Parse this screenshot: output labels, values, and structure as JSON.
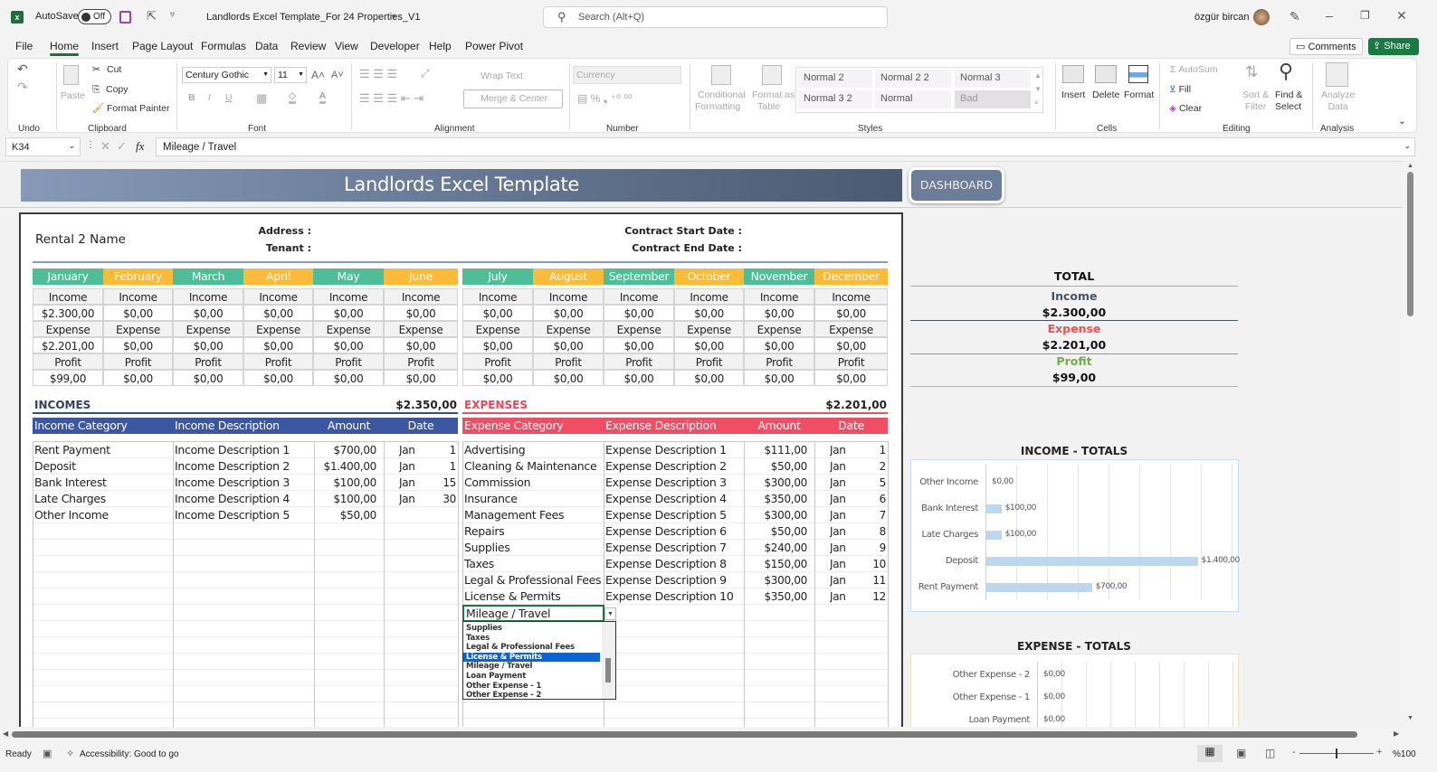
{
  "titlebar": {
    "autosave_label": "AutoSave",
    "autosave_state": "Off",
    "filename": "Landlords Excel Template_For 24 Properties_V1",
    "search_placeholder": "Search (Alt+Q)",
    "user_name": "özgür bircan"
  },
  "menu": {
    "tabs": [
      "File",
      "Home",
      "Insert",
      "Page Layout",
      "Formulas",
      "Data",
      "Review",
      "View",
      "Developer",
      "Help",
      "Power Pivot"
    ],
    "active_tab": "Home",
    "comments_label": "Comments",
    "share_label": "Share"
  },
  "ribbon": {
    "groups": {
      "undo": "Undo",
      "clipboard": "Clipboard",
      "font": "Font",
      "alignment": "Alignment",
      "number": "Number",
      "styles": "Styles",
      "cells": "Cells",
      "editing": "Editing",
      "analysis": "Analysis"
    },
    "paste": "Paste",
    "cut": "Cut",
    "copy": "Copy",
    "format_painter": "Format Painter",
    "font_name": "Century Gothic",
    "font_size": "11",
    "wrap_text": "Wrap Text",
    "merge_center": "Merge & Center",
    "number_format": "Currency",
    "conditional_formatting": [
      "Conditional",
      "Formatting"
    ],
    "format_as_table": [
      "Format as",
      "Table"
    ],
    "styles": [
      "Normal 2",
      "Normal 2 2",
      "Normal 3",
      "Normal 3 2",
      "Normal",
      "Bad"
    ],
    "insert": "Insert",
    "delete": "Delete",
    "format": "Format",
    "autosum": "AutoSum",
    "fill": "Fill",
    "clear": "Clear",
    "sort_filter": [
      "Sort &",
      "Filter"
    ],
    "find_select": [
      "Find &",
      "Select"
    ],
    "analyze_data": [
      "Analyze",
      "Data"
    ]
  },
  "formula_bar": {
    "name_box": "K34",
    "fx": "fx",
    "value": "Mileage / Travel"
  },
  "sheet": {
    "banner_title": "Landlords Excel Template",
    "dashboard_button": "DASHBOARD",
    "rental_name": "Rental 2 Name",
    "address_label": "Address :",
    "tenant_label": "Tenant :",
    "contract_start_label": "Contract Start Date :",
    "contract_end_label": "Contract End Date :",
    "colors": {
      "green": "#4fbd98",
      "orange": "#fbbb3a",
      "income_blue": "#3b57a1",
      "expense_red": "#f14e66"
    },
    "row_labels": [
      "Income",
      "Expense",
      "Profit"
    ],
    "months": [
      {
        "name": "January",
        "income": "$2.300,00",
        "expense": "$2.201,00",
        "profit": "$99,00"
      },
      {
        "name": "February",
        "income": "$0,00",
        "expense": "$0,00",
        "profit": "$0,00"
      },
      {
        "name": "March",
        "income": "$0,00",
        "expense": "$0,00",
        "profit": "$0,00"
      },
      {
        "name": "April",
        "income": "$0,00",
        "expense": "$0,00",
        "profit": "$0,00"
      },
      {
        "name": "May",
        "income": "$0,00",
        "expense": "$0,00",
        "profit": "$0,00"
      },
      {
        "name": "June",
        "income": "$0,00",
        "expense": "$0,00",
        "profit": "$0,00"
      },
      {
        "name": "July",
        "income": "$0,00",
        "expense": "$0,00",
        "profit": "$0,00"
      },
      {
        "name": "August",
        "income": "$0,00",
        "expense": "$0,00",
        "profit": "$0,00"
      },
      {
        "name": "September",
        "income": "$0,00",
        "expense": "$0,00",
        "profit": "$0,00"
      },
      {
        "name": "October",
        "income": "$0,00",
        "expense": "$0,00",
        "profit": "$0,00"
      },
      {
        "name": "November",
        "income": "$0,00",
        "expense": "$0,00",
        "profit": "$0,00"
      },
      {
        "name": "December",
        "income": "$0,00",
        "expense": "$0,00",
        "profit": "$0,00"
      }
    ],
    "incomes": {
      "title": "INCOMES",
      "total": "$2.350,00",
      "headers": [
        "Income Category",
        "Income Description",
        "Amount",
        "Date"
      ],
      "rows": [
        [
          "Rent Payment",
          "Income Description 1",
          "$700,00",
          "Jan",
          "1"
        ],
        [
          "Deposit",
          "Income Description 2",
          "$1.400,00",
          "Jan",
          "1"
        ],
        [
          "Bank Interest",
          "Income Description 3",
          "$100,00",
          "Jan",
          "15"
        ],
        [
          "Late Charges",
          "Income Description 4",
          "$100,00",
          "Jan",
          "30"
        ],
        [
          "Other Income",
          "Income Description 5",
          "$50,00",
          "",
          ""
        ]
      ]
    },
    "expenses": {
      "title": "EXPENSES",
      "total": "$2.201,00",
      "headers": [
        "Expense Category",
        "Expense Description",
        "Amount",
        "Date"
      ],
      "rows": [
        [
          "Advertising",
          "Expense Description 1",
          "$111,00",
          "Jan",
          "1"
        ],
        [
          "Cleaning & Maintenance",
          "Expense Description 2",
          "$50,00",
          "Jan",
          "2"
        ],
        [
          "Commission",
          "Expense Description 3",
          "$300,00",
          "Jan",
          "5"
        ],
        [
          "Insurance",
          "Expense Description 4",
          "$350,00",
          "Jan",
          "6"
        ],
        [
          "Management Fees",
          "Expense Description 5",
          "$300,00",
          "Jan",
          "7"
        ],
        [
          "Repairs",
          "Expense Description 6",
          "$50,00",
          "Jan",
          "8"
        ],
        [
          "Supplies",
          "Expense Description 7",
          "$240,00",
          "Jan",
          "9"
        ],
        [
          "Taxes",
          "Expense Description 8",
          "$150,00",
          "Jan",
          "10"
        ],
        [
          "Legal & Professional Fees",
          "Expense Description 9",
          "$300,00",
          "Jan",
          "11"
        ],
        [
          "License & Permits",
          "Expense Description 10",
          "$350,00",
          "Jan",
          "12"
        ]
      ],
      "active_cell_value": "Mileage / Travel",
      "dropdown_options": [
        "Supplies",
        "Taxes",
        "Legal & Professional Fees",
        "License & Permits",
        "Mileage / Travel",
        "Loan Payment",
        "Other Expense - 1",
        "Other Expense - 2"
      ],
      "dropdown_highlighted": "License & Permits"
    },
    "totals": {
      "title": "TOTAL",
      "income_label": "Income",
      "income": "$2.300,00",
      "expense_label": "Expense",
      "expense": "$2.201,00",
      "profit_label": "Profit",
      "profit": "$99,00",
      "colors": {
        "income": "#44546a",
        "expense": "#f05252",
        "profit": "#70ad47"
      }
    }
  },
  "chart_data": [
    {
      "type": "bar",
      "orientation": "horizontal",
      "title": "INCOME - TOTALS",
      "categories": [
        "Other Income",
        "Bank Interest",
        "Late Charges",
        "Deposit",
        "Rent Payment"
      ],
      "values": [
        0,
        100,
        100,
        1400,
        700
      ],
      "labels": [
        "$0,00",
        "$100,00",
        "$100,00",
        "$1.400,00",
        "$700,00"
      ],
      "xlim": [
        0,
        1600
      ],
      "grid": true,
      "color": "#bdd7ee"
    },
    {
      "type": "bar",
      "orientation": "horizontal",
      "title": "EXPENSE - TOTALS",
      "categories": [
        "Other Expense - 2",
        "Other Expense - 1",
        "Loan Payment"
      ],
      "values": [
        0,
        0,
        0
      ],
      "labels": [
        "$0,00",
        "$0,00",
        "$0,00"
      ],
      "grid": true
    }
  ],
  "status": {
    "ready": "Ready",
    "accessibility": "Accessibility: Good to go",
    "zoom": "%100"
  }
}
